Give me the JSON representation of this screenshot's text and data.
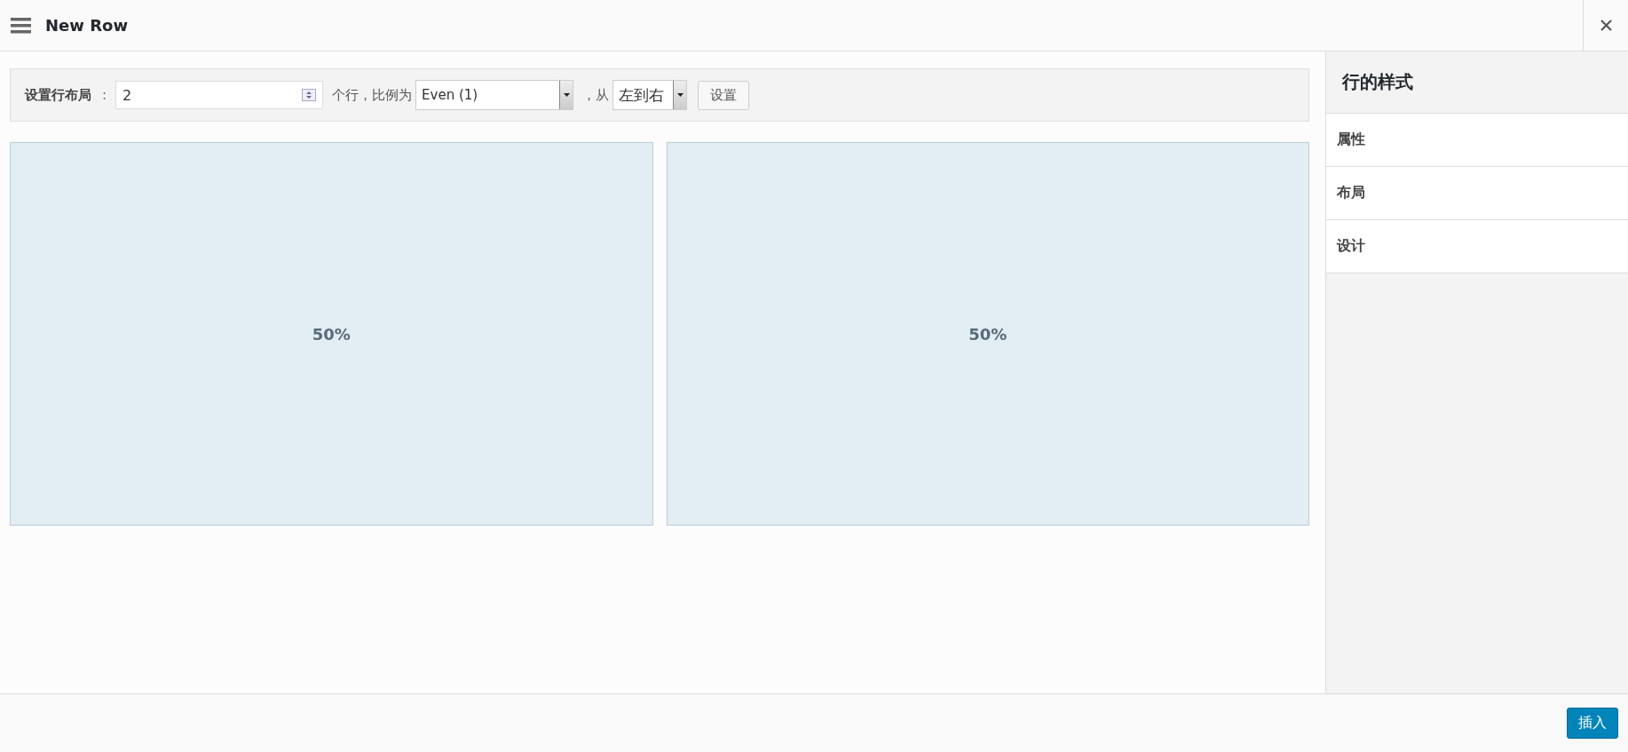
{
  "window": {
    "title": "New Row"
  },
  "layout_bar": {
    "label": "设置行布局",
    "separator": ":",
    "columns_value": "2",
    "columns_suffix": "个行，比例为",
    "ratio": "Even (1)",
    "direction_prefix": "，从",
    "direction": "左到右",
    "set_button": "设置"
  },
  "columns": [
    {
      "label": "50%"
    },
    {
      "label": "50%"
    }
  ],
  "sidebar": {
    "title": "行的样式",
    "items": [
      {
        "label": "属性"
      },
      {
        "label": "布局"
      },
      {
        "label": "设计"
      }
    ]
  },
  "footer": {
    "insert_button": "插入"
  }
}
